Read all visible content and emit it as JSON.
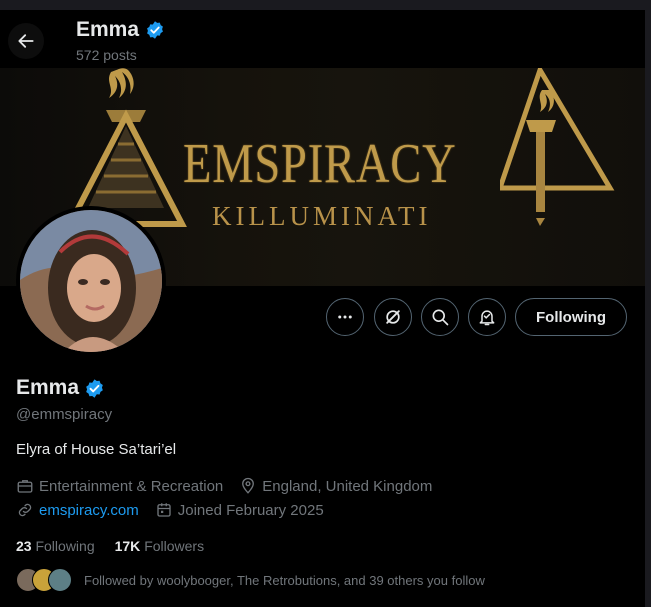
{
  "header": {
    "name": "Emma",
    "posts": "572 posts"
  },
  "banner": {
    "title": "EMSPIRACY",
    "subtitle": "KILLUMINATI"
  },
  "actions": {
    "following_label": "Following"
  },
  "profile": {
    "name": "Emma",
    "handle": "@emmspiracy",
    "bio": "Elyra of House Sa’tari’el",
    "category": "Entertainment & Recreation",
    "location": "England, United Kingdom",
    "website": "emspiracy.com",
    "joined": "Joined February 2025"
  },
  "stats": {
    "following_count": "23",
    "following_label": "Following",
    "followers_count": "17K",
    "followers_label": "Followers"
  },
  "followed_by": "Followed by woolybooger, The Retrobutions, and 39 others you follow",
  "colors": {
    "accent": "#1d9bf0",
    "gold": "#bf9a4a",
    "muted": "#71767b"
  }
}
